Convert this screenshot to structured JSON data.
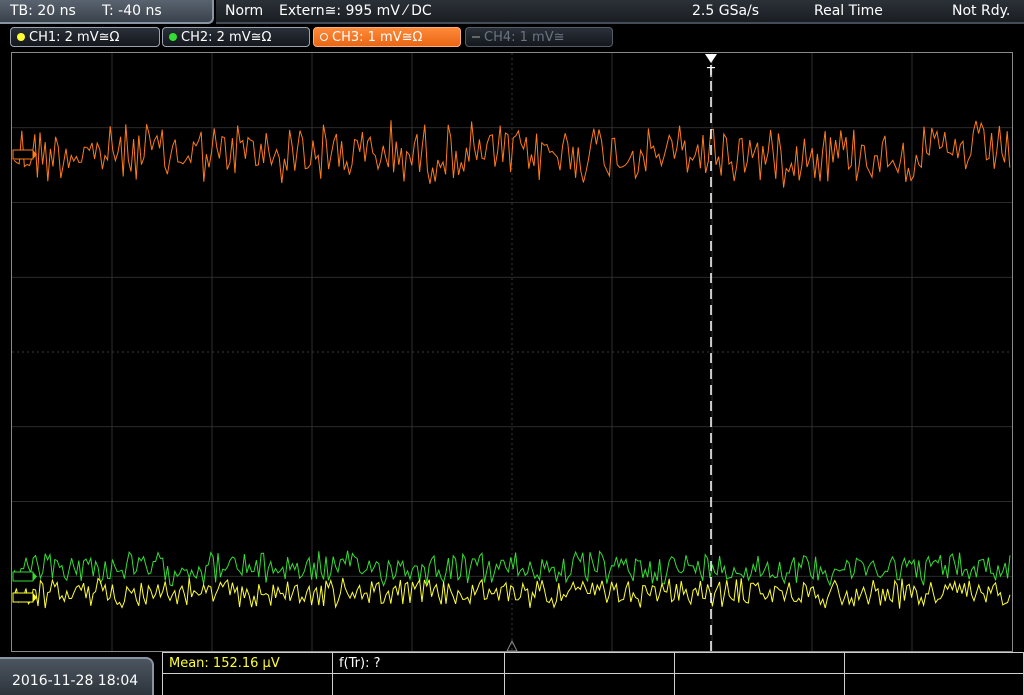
{
  "header": {
    "timebase": "TB: 20 ns",
    "trigger_time": "T: -40 ns",
    "acq_mode": "Norm",
    "trigger_source": "Extern≅: 995 mV ⁄ DC",
    "sample_rate": "2.5 GSa/s",
    "time_mode": "Real Time",
    "status": "Not Rdy."
  },
  "channels": [
    {
      "label": "CH1: 2 mV≅Ω",
      "color": "#ffff33",
      "state": "on"
    },
    {
      "label": "CH2: 2 mV≅Ω",
      "color": "#33dd33",
      "state": "on"
    },
    {
      "label": "CH3: 1 mV≅Ω",
      "color": "#ff7a1a",
      "state": "active"
    },
    {
      "label": "CH4: 1 mV≅",
      "color": "#666666",
      "state": "off"
    }
  ],
  "screen": {
    "trigger_marker": "T",
    "grid_color": "#3a3a3a",
    "trigger_line_color": "#ffffff"
  },
  "footer": {
    "datetime": "2016-11-28 18:04",
    "measurements": {
      "mean": "Mean: 152.16 µV",
      "f_tr": "f(Tr): ?"
    },
    "mean_color": "#ffff33"
  }
}
